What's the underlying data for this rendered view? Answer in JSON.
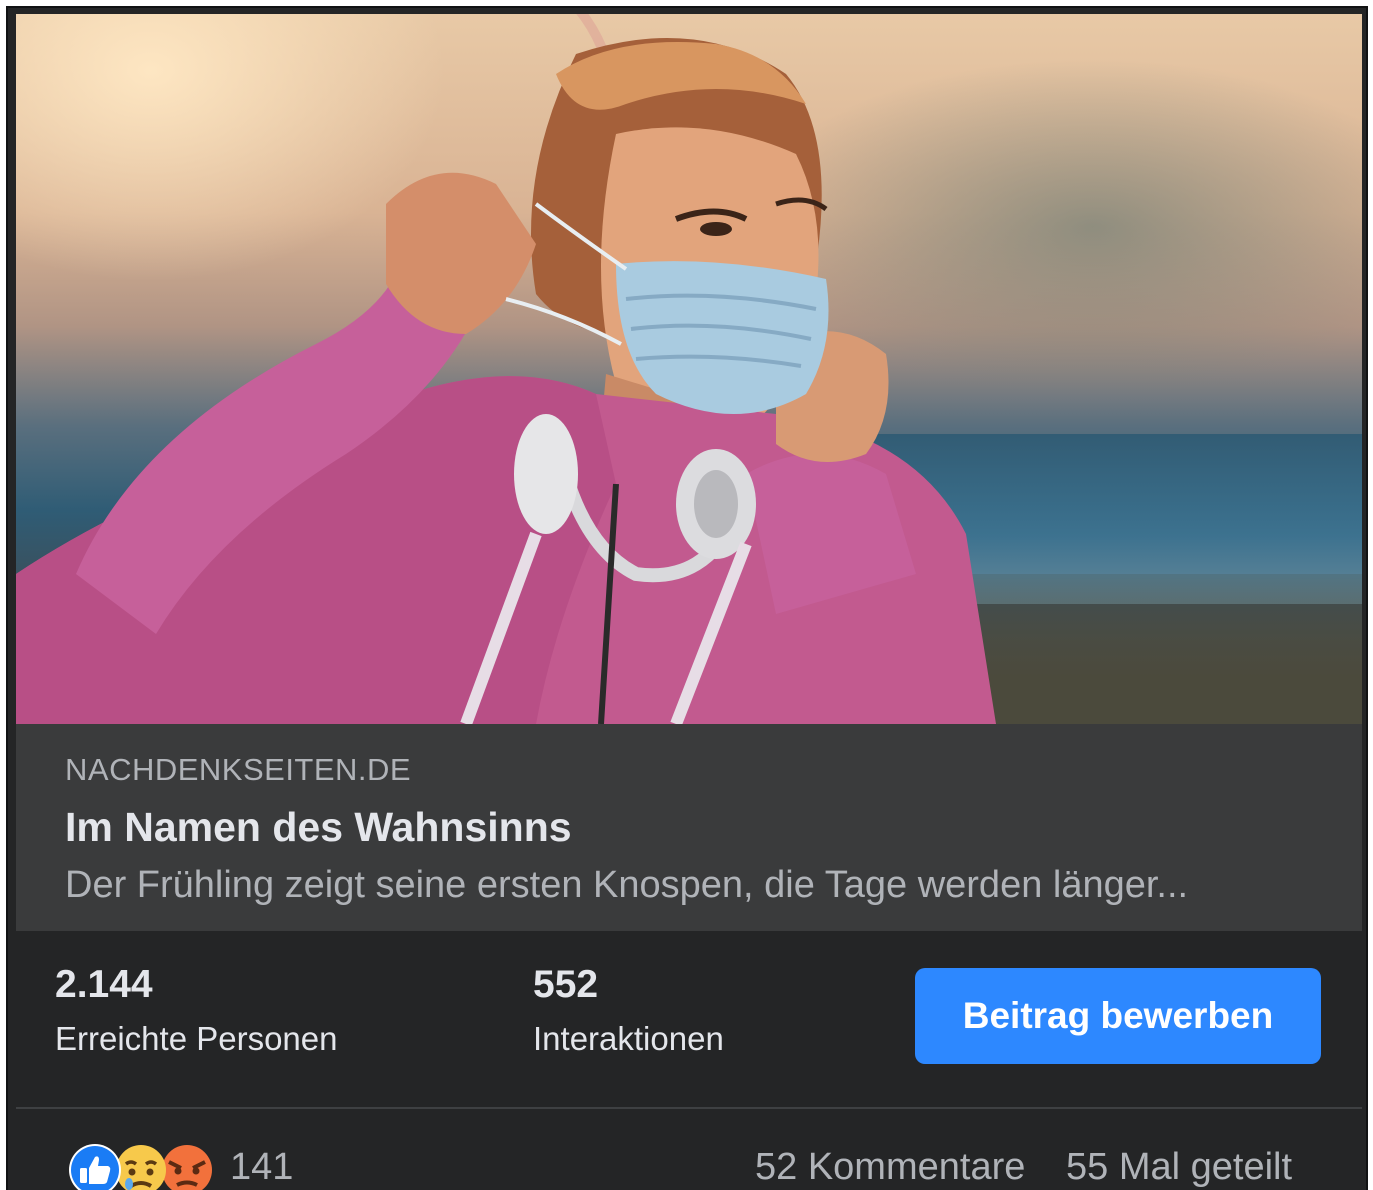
{
  "link_preview": {
    "domain": "NACHDENKSEITEN.DE",
    "title": "Im Namen des Wahnsinns",
    "description": "Der Frühling zeigt seine ersten Knospen, die Tage werden länger..."
  },
  "stats": {
    "reach": {
      "value": "2.144",
      "label": "Erreichte Personen"
    },
    "interactions": {
      "value": "552",
      "label": "Interaktionen"
    }
  },
  "actions": {
    "boost_label": "Beitrag bewerben"
  },
  "reactions": {
    "icons": [
      "like-icon",
      "sad-icon",
      "angry-icon"
    ],
    "count": "141"
  },
  "engagement": {
    "comments": "52 Kommentare",
    "shares": "55 Mal geteilt"
  },
  "colors": {
    "background": "#242526",
    "preview_background": "#3a3b3c",
    "primary_text": "#e4e6eb",
    "secondary_text": "#b0b3b8",
    "accent": "#2d88ff"
  }
}
